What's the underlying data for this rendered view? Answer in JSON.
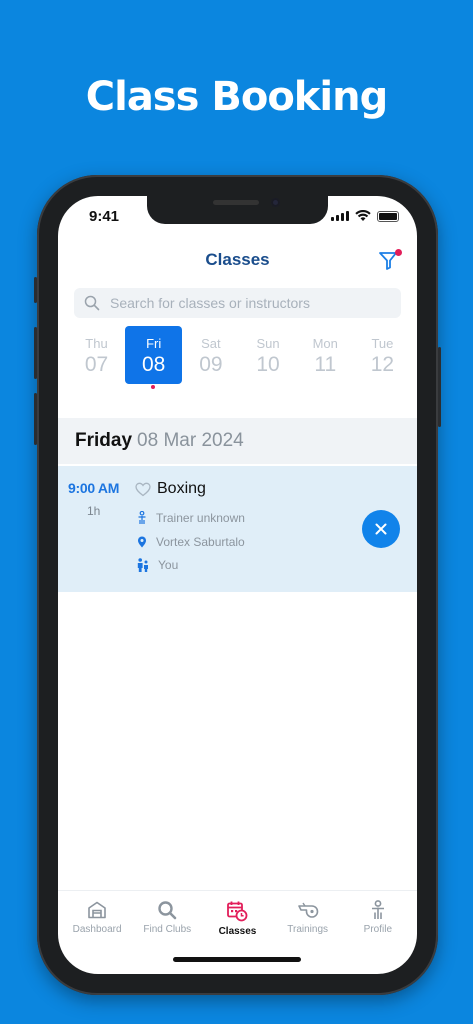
{
  "promo": {
    "title": "Class Booking"
  },
  "status_bar": {
    "time": "9:41"
  },
  "header": {
    "title": "Classes",
    "filter_icon": "filter-icon",
    "accent": "#1a4d8c"
  },
  "search": {
    "placeholder": "Search for classes or instructors",
    "value": ""
  },
  "days": [
    {
      "name": "Thu",
      "num": "07",
      "selected": false
    },
    {
      "name": "Fri",
      "num": "08",
      "selected": true,
      "has_booking": true
    },
    {
      "name": "Sat",
      "num": "09",
      "selected": false
    },
    {
      "name": "Sun",
      "num": "10",
      "selected": false
    },
    {
      "name": "Mon",
      "num": "11",
      "selected": false
    },
    {
      "name": "Tue",
      "num": "12",
      "selected": false
    }
  ],
  "date_header": {
    "weekday": "Friday",
    "date": "08 Mar 2024"
  },
  "class_item": {
    "time": "9:00 AM",
    "duration": "1h",
    "name": "Boxing",
    "trainer": "Trainer unknown",
    "location": "Vortex Saburtalo",
    "attendee": "You"
  },
  "tabs": [
    {
      "label": "Dashboard",
      "icon": "home-icon",
      "active": false
    },
    {
      "label": "Find Clubs",
      "icon": "search-icon",
      "active": false
    },
    {
      "label": "Classes",
      "icon": "calendar-clock-icon",
      "active": true
    },
    {
      "label": "Trainings",
      "icon": "whistle-icon",
      "active": false
    },
    {
      "label": "Profile",
      "icon": "profile-icon",
      "active": false
    }
  ],
  "colors": {
    "background": "#0b86df",
    "primary": "#0f74e8",
    "badge": "#e21e5a",
    "active_tab": "#e21e5a"
  }
}
